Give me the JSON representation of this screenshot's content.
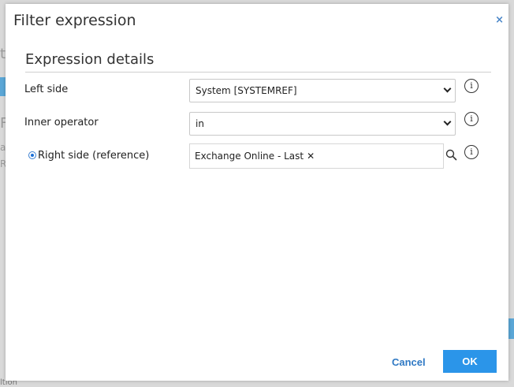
{
  "dialog": {
    "title": "Filter expression",
    "close_glyph": "×",
    "section_title": "Expression details"
  },
  "fields": {
    "left_side": {
      "label": "Left side",
      "value": "System [SYSTEMREF]"
    },
    "inner_operator": {
      "label": "Inner operator",
      "value": "in"
    },
    "right_side": {
      "label": "Right side (reference)",
      "tag": "Exchange Online - Last",
      "tag_remove_glyph": "✕"
    }
  },
  "icons": {
    "info": "info-icon",
    "info_glyph": "i",
    "search": "search-icon",
    "close": "close-icon",
    "dropdown": "chevron-down-icon"
  },
  "buttons": {
    "cancel": "Cancel",
    "ok": "OK"
  },
  "background_fragments": {
    "t1": "t",
    "t2": "Fi",
    "t3": "a",
    "t4": "Ro",
    "bottom": "ltion"
  },
  "colors": {
    "accent": "#2b95e9",
    "link": "#2f79c4",
    "close": "#4a86c8"
  }
}
